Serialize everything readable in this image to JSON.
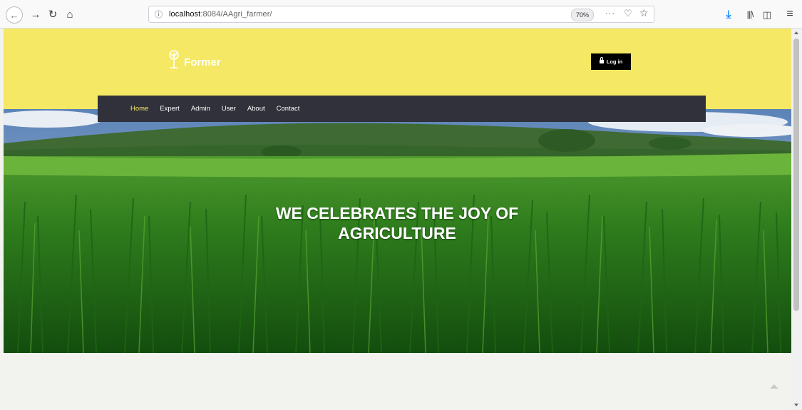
{
  "browser": {
    "url_host": "localhost",
    "url_rest": ":8084/AAgri_farmer/",
    "zoom": "70%",
    "more_label": "···"
  },
  "site": {
    "brand": "Former",
    "login_label": "Log in"
  },
  "nav": {
    "items": [
      {
        "label": "Home"
      },
      {
        "label": "Expert"
      },
      {
        "label": "Admin"
      },
      {
        "label": "User"
      },
      {
        "label": "About"
      },
      {
        "label": "Contact"
      }
    ]
  },
  "hero": {
    "heading": "WE CELEBRATES THE JOY OF AGRICULTURE"
  },
  "colors": {
    "header_bg": "#f4e864",
    "nav_bg": "#30313b",
    "nav_active": "#f4e864",
    "login_bg": "#000000"
  }
}
